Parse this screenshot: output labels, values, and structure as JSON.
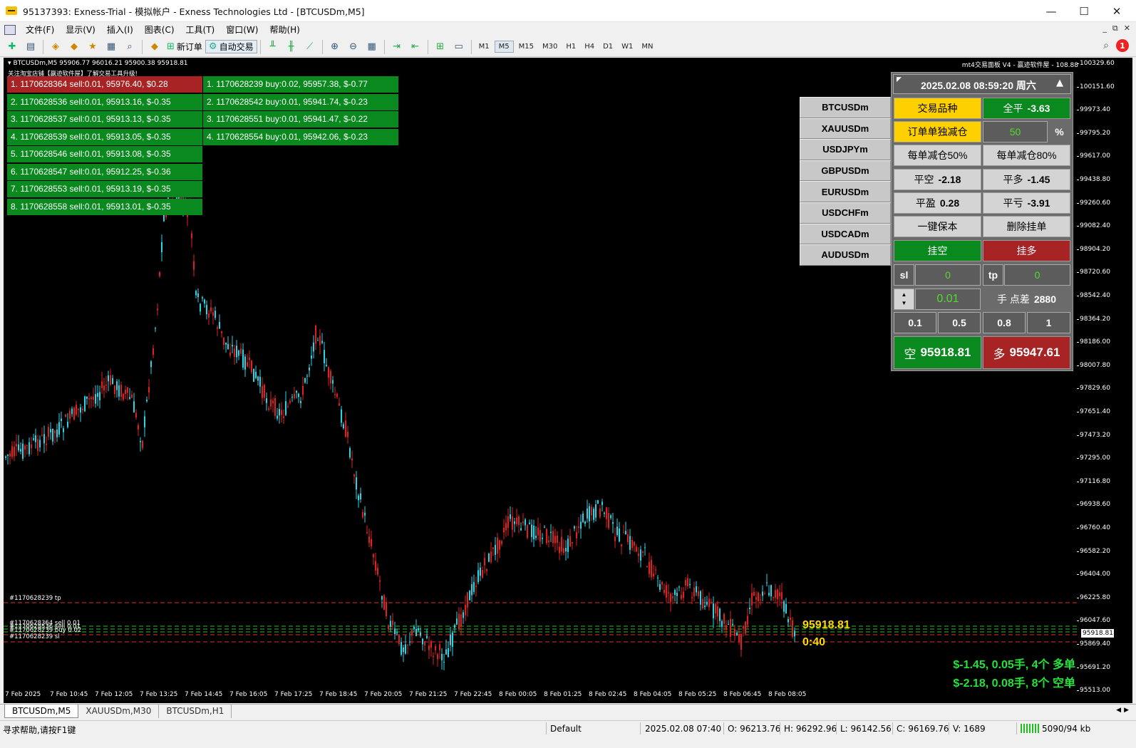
{
  "window": {
    "title": "95137393: Exness-Trial - 模拟帐户 - Exness Technologies Ltd - [BTCUSDm,M5]",
    "minimize": "—",
    "maximize": "☐",
    "close": "✕"
  },
  "menu": [
    "文件(F)",
    "显示(V)",
    "插入(I)",
    "图表(C)",
    "工具(T)",
    "窗口(W)",
    "帮助(H)"
  ],
  "toolbar": {
    "new_order": "新订单",
    "auto_trading": "自动交易",
    "timeframes": [
      "M1",
      "M5",
      "M15",
      "M30",
      "H1",
      "H4",
      "D1",
      "W1",
      "MN"
    ],
    "active_timeframe": "M5",
    "notification_count": "1"
  },
  "chart": {
    "info": "BTCUSDm,M5  95906.77 96016.21 95900.38 95918.81",
    "notice": "关注淘宝店铺【赢迹软件屋】了解交易工具升级!",
    "panel_name": "mt4交易面板 V4 - 赢迹软件屋 - 108.88",
    "y_ticks": [
      "100329.60",
      "100151.60",
      "99973.40",
      "99795.20",
      "99617.00",
      "99438.80",
      "99260.60",
      "99082.40",
      "98904.20",
      "98720.60",
      "98542.40",
      "98364.20",
      "98186.00",
      "98007.80",
      "97829.60",
      "97651.40",
      "97473.20",
      "97295.00",
      "97116.80",
      "96938.60",
      "96760.40",
      "96582.20",
      "96404.00",
      "96225.80",
      "96047.60",
      "95869.40",
      "95691.20",
      "95513.00"
    ],
    "price_label": "95918.81",
    "x_ticks": [
      "7 Feb 2025",
      "7 Feb 10:45",
      "7 Feb 12:05",
      "7 Feb 13:25",
      "7 Feb 14:45",
      "7 Feb 16:05",
      "7 Feb 17:25",
      "7 Feb 18:45",
      "7 Feb 20:05",
      "7 Feb 21:25",
      "7 Feb 22:45",
      "8 Feb 00:05",
      "8 Feb 01:25",
      "8 Feb 02:45",
      "8 Feb 04:05",
      "8 Feb 05:25",
      "8 Feb 06:45",
      "8 Feb 08:05"
    ],
    "sell_orders": [
      "1. 1170628364 sell:0.01, 95976.40, $0.28",
      "2. 1170628536 sell:0.01, 95913.16, $-0.35",
      "3. 1170628537 sell:0.01, 95913.13, $-0.35",
      "4. 1170628539 sell:0.01, 95913.05, $-0.35",
      "5. 1170628546 sell:0.01, 95913.08, $-0.35",
      "6. 1170628547 sell:0.01, 95912.25, $-0.36",
      "7. 1170628553 sell:0.01, 95913.19, $-0.35",
      "8. 1170628558 sell:0.01, 95913.01, $-0.35"
    ],
    "buy_orders": [
      "1. 1170628239 buy:0.02, 95957.38, $-0.77",
      "2. 1170628542 buy:0.01, 95941.74, $-0.23",
      "3. 1170628551 buy:0.01, 95941.47, $-0.22",
      "4. 1170628554 buy:0.01, 95942.06, $-0.23"
    ],
    "line_labels": {
      "tp": "#1170628239 tp",
      "sl": "#1170628239 sl",
      "stack1": "#1170628364 sell 0.01",
      "stack2": "#1170628536 sell 0.01",
      "stack3": "#1170628239 buy 0.02"
    },
    "bid_text": "95918.81",
    "timer_text": "0:40",
    "summary_buy": "$-1.45, 0.05手, 4个  多单",
    "summary_sell": "$-2.18, 0.08手, 8个   空单"
  },
  "symbols": [
    "BTCUSDm",
    "XAUUSDm",
    "USDJPYm",
    "GBPUSDm",
    "EURUSDm",
    "USDCHFm",
    "USDCADm",
    "AUDUSDm"
  ],
  "panel": {
    "datetime": "2025.02.08 08:59:20 周六",
    "arrow": "▲",
    "symbol_btn": "交易品种",
    "close_all": "全平",
    "close_all_val": "-3.63",
    "single_reduce": "订单单独减仓",
    "percent_value": "50",
    "percent_sign": "%",
    "reduce50": "每单减仓50%",
    "reduce80": "每单减仓80%",
    "close_short": "平空",
    "close_short_val": "-2.18",
    "close_long": "平多",
    "close_long_val": "-1.45",
    "close_profit": "平盈",
    "close_profit_val": "0.28",
    "close_loss": "平亏",
    "close_loss_val": "-3.91",
    "breakeven": "一键保本",
    "delete_pending": "删除挂单",
    "pending_sell": "挂空",
    "pending_buy": "挂多",
    "sl_label": "sl",
    "sl_value": "0",
    "tp_label": "tp",
    "tp_value": "0",
    "lot_value": "0.01",
    "lot_unit": "手",
    "spread_label": "点差",
    "spread_value": "2880",
    "presets": [
      "0.1",
      "0.5",
      "0.8",
      "1"
    ],
    "sell_label": "空",
    "sell_price": "95918.81",
    "buy_label": "多",
    "buy_price": "95947.61"
  },
  "tabs": [
    "BTCUSDm,M5",
    "XAUUSDm,M30",
    "BTCUSDm,H1"
  ],
  "status": {
    "help": "寻求帮助,请按F1键",
    "profile": "Default",
    "datetime": "2025.02.08 07:40",
    "open": "O: 96213.76",
    "high": "H: 96292.96",
    "low": "L: 96142.56",
    "close": "C: 96169.76",
    "volume": "V: 1689",
    "traffic": "5090/94 kb"
  }
}
